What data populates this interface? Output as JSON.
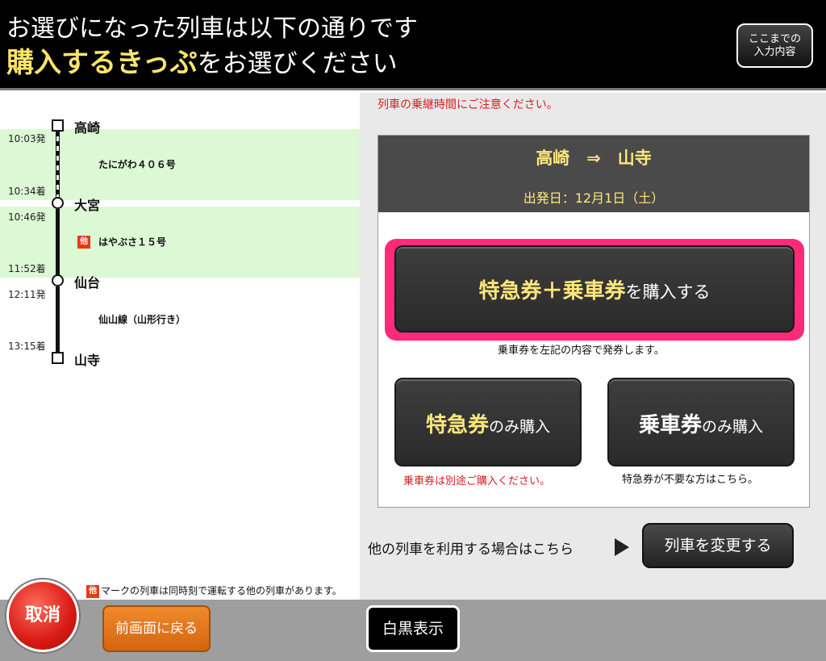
{
  "header": {
    "line1": "お選びになった列車は以下の通りです",
    "line2_highlight": "購入するきっぷ",
    "line2_rest": "をお選びください",
    "review_line1": "ここまでの",
    "review_line2": "入力内容"
  },
  "itinerary": {
    "stations": [
      "高崎",
      "大宮",
      "仙台",
      "山寺"
    ],
    "segments": [
      {
        "depart": "10:03発",
        "arrive": "10:34着",
        "train": "たにがわ４０６号",
        "other_mark": false
      },
      {
        "depart": "10:46発",
        "arrive": "11:52着",
        "train": "はやぶさ１５号",
        "other_mark": true
      },
      {
        "depart": "12:11発",
        "arrive": "13:15着",
        "train": "仙山線（山形行き）",
        "other_mark": false
      }
    ],
    "other_mark_label": "他",
    "note": "マークの列車は同時刻で運転する他の列車があります。"
  },
  "panel": {
    "caution": "列車の乗継時間にご注意ください。",
    "route": "高崎　⇒　山寺",
    "date": "出発日：12月1日（土）",
    "primary_yellow": "特急券＋乗車券",
    "primary_rest": "を購入する",
    "primary_note": "乗車券を左記の内容で発券します。",
    "express_yellow": "特急券",
    "express_rest": "のみ購入",
    "express_note": "乗車券は別途ご購入ください。",
    "ticket_white": "乗車券",
    "ticket_rest": "のみ購入",
    "ticket_note": "特急券が不要な方はこちら。",
    "change_text": "他の列車を利用する場合はこちら",
    "change_button": "列車を変更する"
  },
  "footer": {
    "cancel": "取消",
    "back": "前画面に戻る",
    "mono": "白黒表示"
  },
  "colors": {
    "accent_yellow": "#ffe77a",
    "highlight_pink": "#ff2a78",
    "caution_red": "#d42020",
    "band_green": "#dcf8d4",
    "cancel_red": "#d81a14",
    "back_orange": "#f08a2c"
  }
}
